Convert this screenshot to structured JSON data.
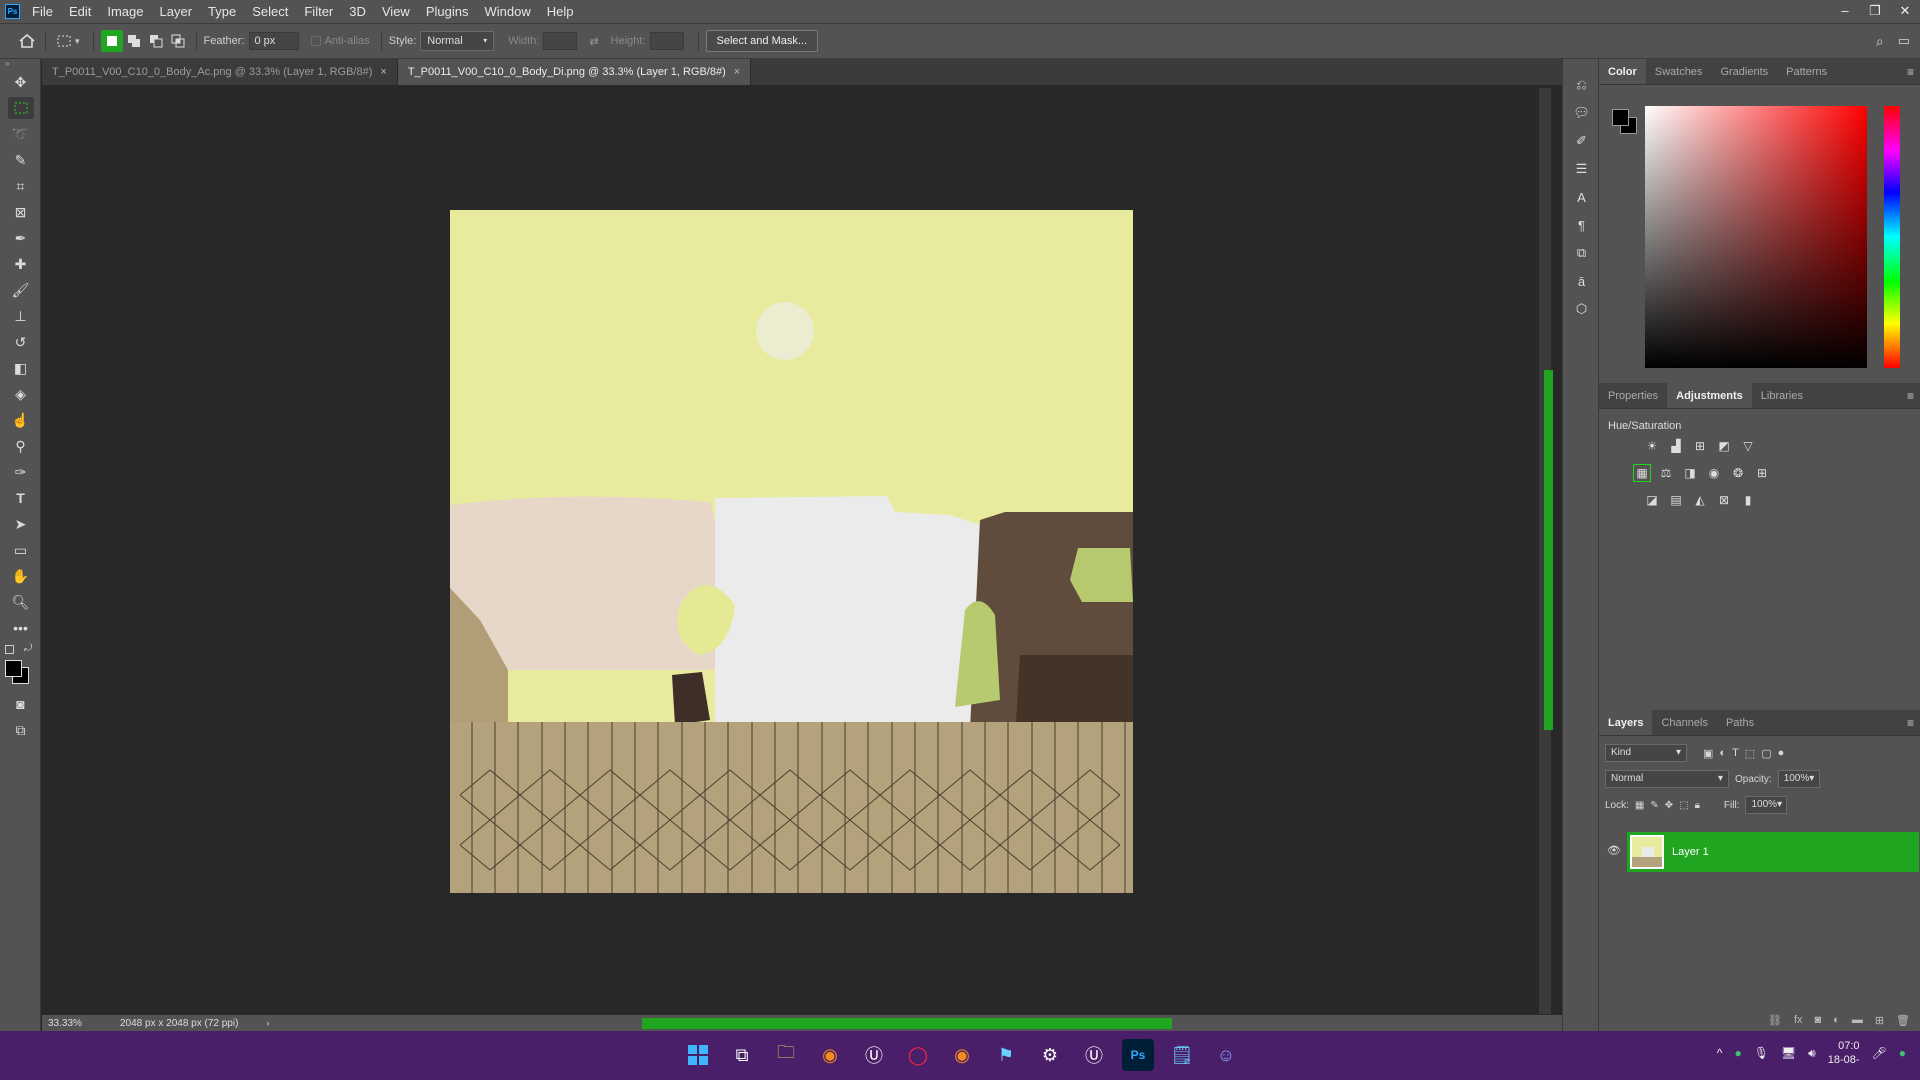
{
  "app": {
    "logo": "Ps"
  },
  "menu": [
    "File",
    "Edit",
    "Image",
    "Layer",
    "Type",
    "Select",
    "Filter",
    "3D",
    "View",
    "Plugins",
    "Window",
    "Help"
  ],
  "window_controls": {
    "minimize": "–",
    "restore": "❐",
    "close": "✕"
  },
  "options_bar": {
    "feather_label": "Feather:",
    "feather_value": "0 px",
    "antialias_label": "Anti-alias",
    "style_label": "Style:",
    "style_value": "Normal",
    "width_label": "Width:",
    "height_label": "Height:",
    "select_mask_button": "Select and Mask..."
  },
  "tabs": [
    {
      "label": "T_P0011_V00_C10_0_Body_Ac.png @ 33.3% (Layer 1, RGB/8#)"
    },
    {
      "label": "T_P0011_V00_C10_0_Body_Di.png @ 33.3% (Layer 1, RGB/8#)"
    }
  ],
  "status": {
    "zoom": "33.33%",
    "doc_size": "2048 px x 2048 px (72 ppi)"
  },
  "color_panel": {
    "tabs": [
      "Color",
      "Swatches",
      "Gradients",
      "Patterns"
    ]
  },
  "adjust_panel": {
    "tabs": [
      "Properties",
      "Adjustments",
      "Libraries"
    ],
    "title": "Hue/Saturation"
  },
  "layers_panel": {
    "tabs": [
      "Layers",
      "Channels",
      "Paths"
    ],
    "kind_label": "Kind",
    "blend_mode": "Normal",
    "opacity_label": "Opacity:",
    "opacity_value": "100%",
    "lock_label": "Lock:",
    "fill_label": "Fill:",
    "fill_value": "100%",
    "layers": [
      {
        "name": "Layer 1",
        "visible": true,
        "selected": true
      }
    ]
  },
  "taskbar": {
    "time": "07:0",
    "date": "18-08-"
  },
  "colors": {
    "accent": "#1fa51f",
    "taskbar": "#4a1f6a",
    "panel": "#535353",
    "canvas_bg": "#282828"
  }
}
